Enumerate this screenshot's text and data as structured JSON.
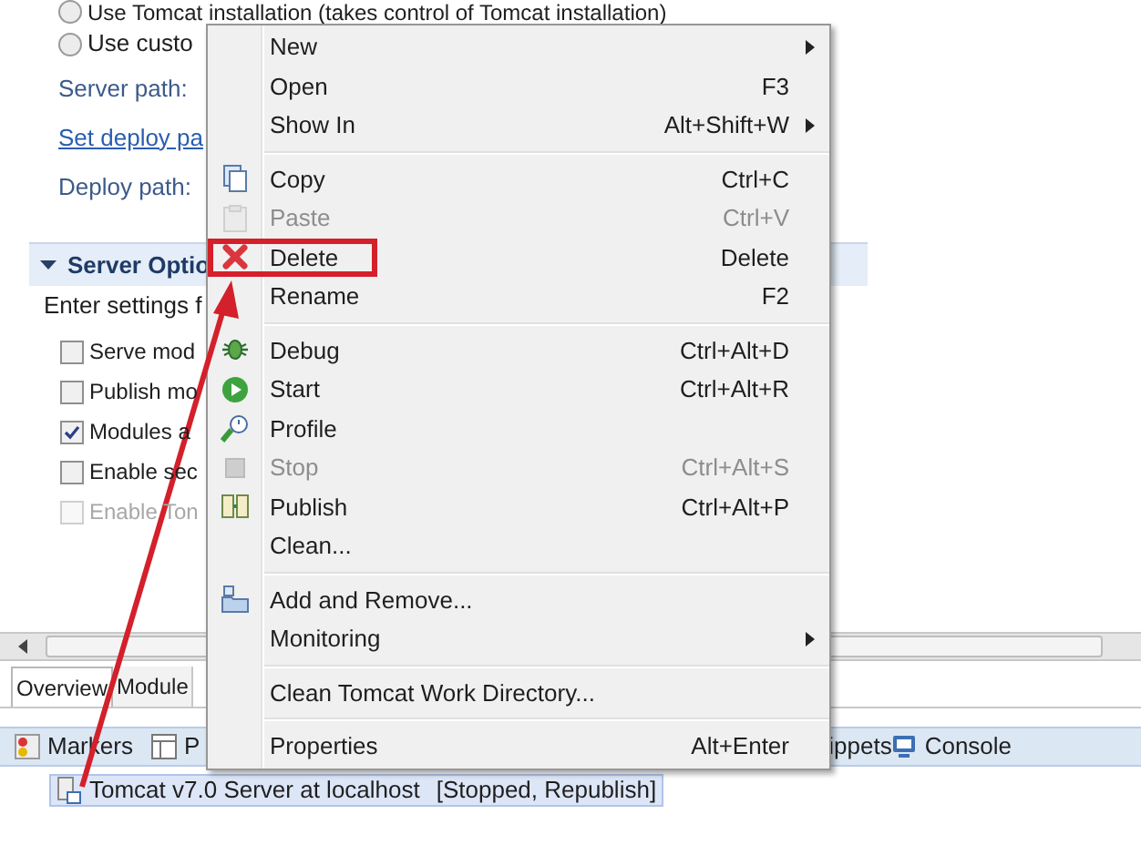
{
  "editor": {
    "options": [
      {
        "kind": "radio",
        "label": "Use Tomcat installation (takes control of Tomcat installation)",
        "selected": false
      },
      {
        "kind": "radio",
        "label": "Use custo",
        "selected": false
      },
      {
        "kind": "label",
        "label": "Server path:"
      },
      {
        "kind": "link",
        "label": "Set deploy pa"
      },
      {
        "kind": "label",
        "label": "Deploy path:"
      }
    ],
    "section": {
      "title": "Server Optio",
      "expanded": true,
      "description": "Enter settings f",
      "checkboxes": [
        {
          "label": "Serve mod",
          "checked": false,
          "disabled": false
        },
        {
          "label": "Publish mo",
          "checked": false,
          "disabled": false
        },
        {
          "label": "Modules a",
          "checked": true,
          "disabled": false
        },
        {
          "label": "Enable sec",
          "checked": false,
          "disabled": false
        },
        {
          "label": "Enable Ton",
          "checked": false,
          "disabled": true
        }
      ]
    },
    "tabs": [
      {
        "label": "Overview",
        "selected": true
      },
      {
        "label": "Module",
        "selected": false
      }
    ]
  },
  "panel": {
    "tabs": [
      {
        "label": "Markers"
      },
      {
        "label": "P"
      },
      {
        "label": "ippets"
      },
      {
        "label": "Console"
      }
    ],
    "servers": [
      {
        "name": "Tomcat v7.0 Server at localhost",
        "status": "[Stopped, Republish]",
        "selected": true
      }
    ]
  },
  "context_menu": {
    "items": [
      {
        "kind": "item",
        "label": "New",
        "submenu": true,
        "disabled": false,
        "highlighted": false
      },
      {
        "kind": "item",
        "label": "Open",
        "shortcut": "F3",
        "submenu": false,
        "disabled": false,
        "highlighted": false
      },
      {
        "kind": "item",
        "label": "Show In",
        "shortcut": "Alt+Shift+W",
        "submenu": true,
        "disabled": false,
        "highlighted": false
      },
      {
        "kind": "separator"
      },
      {
        "kind": "item",
        "label": "Copy",
        "shortcut": "Ctrl+C",
        "submenu": false,
        "disabled": false,
        "highlighted": false
      },
      {
        "kind": "item",
        "label": "Paste",
        "shortcut": "Ctrl+V",
        "submenu": false,
        "disabled": true,
        "highlighted": false
      },
      {
        "kind": "item",
        "label": "Delete",
        "shortcut": "Delete",
        "submenu": false,
        "disabled": false,
        "highlighted": true
      },
      {
        "kind": "item",
        "label": "Rename",
        "shortcut": "F2",
        "submenu": false,
        "disabled": false,
        "highlighted": false
      },
      {
        "kind": "separator"
      },
      {
        "kind": "item",
        "label": "Debug",
        "shortcut": "Ctrl+Alt+D",
        "submenu": false,
        "disabled": false,
        "highlighted": false
      },
      {
        "kind": "item",
        "label": "Start",
        "shortcut": "Ctrl+Alt+R",
        "submenu": false,
        "disabled": false,
        "highlighted": false
      },
      {
        "kind": "item",
        "label": "Profile",
        "submenu": false,
        "disabled": false,
        "highlighted": false
      },
      {
        "kind": "item",
        "label": "Stop",
        "shortcut": "Ctrl+Alt+S",
        "submenu": false,
        "disabled": true,
        "highlighted": false
      },
      {
        "kind": "item",
        "label": "Publish",
        "shortcut": "Ctrl+Alt+P",
        "submenu": false,
        "disabled": false,
        "highlighted": false
      },
      {
        "kind": "item",
        "label": "Clean...",
        "submenu": false,
        "disabled": false,
        "highlighted": false
      },
      {
        "kind": "separator"
      },
      {
        "kind": "item",
        "label": "Add and Remove...",
        "submenu": false,
        "disabled": false,
        "highlighted": false
      },
      {
        "kind": "item",
        "label": "Monitoring",
        "submenu": true,
        "disabled": false,
        "highlighted": false
      },
      {
        "kind": "separator"
      },
      {
        "kind": "item",
        "label": "Clean Tomcat Work Directory...",
        "submenu": false,
        "disabled": false,
        "highlighted": false
      },
      {
        "kind": "separator"
      },
      {
        "kind": "item",
        "label": "Properties",
        "shortcut": "Alt+Enter",
        "submenu": false,
        "disabled": false,
        "highlighted": false
      }
    ]
  }
}
